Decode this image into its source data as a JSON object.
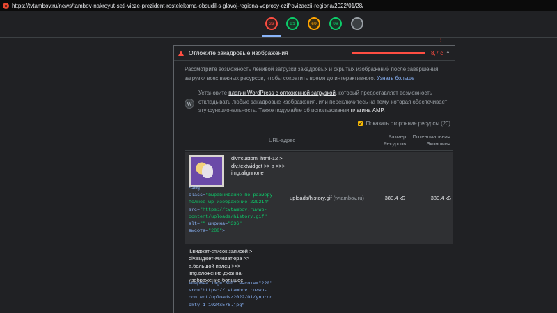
{
  "browser": {
    "url": "https://tvtambov.ru/news/tambov-nakroyut-seti-vicze-prezident-rostelekoma-obsudil-s-glavoj-regiona-voprosy-czifrovizaczii-regiona/2022/01/28/"
  },
  "scores": [
    {
      "label": "23",
      "status": "red",
      "active": true
    },
    {
      "label": "91",
      "status": "green",
      "active": false
    },
    {
      "label": "69",
      "status": "orange",
      "active": false
    },
    {
      "label": "98",
      "status": "green",
      "active": false
    },
    {
      "label": "—",
      "status": "pwa",
      "active": false
    }
  ],
  "marker": "!",
  "audit": {
    "title": "Отложите закадровые изображения",
    "savings": "8,7 с",
    "description_pre": "Рассмотрите возможность ленивой загрузки закадровых и скрытых изображений после завершения загрузки всех важных ресурсов, чтобы сократить время до интерактивного.",
    "description_link": "Узнать больше",
    "stack_icon_glyph": "W",
    "stack_pre": "Установите",
    "stack_link1": "плагин WordPress с отложенной загрузкой",
    "stack_mid": ", который предоставляет возможность откладывать любые закадровые изображения, или переключитесь на тему, которая обеспечивает эту функциональность. Также подумайте об использовании",
    "stack_link2": "плагина AMP",
    "stack_post": ".",
    "third_party_label": "Показать сторонние ресурсы (20)",
    "third_party_checked": true
  },
  "table": {
    "col_url": "URL-адрес",
    "col_size": "Размер Ресурсов",
    "col_savings": "Потенциальная Экономия",
    "rows": [
      {
        "node_label": "div#custom_html-12 > div.textwidget >> a >>> img.alignnone",
        "snippet": {
          "l1_tag": "<img",
          "l2_attr": "class=",
          "l2_val": "\"выравнивание по размеру-полное wp-изображение-229214\"",
          "l3_attr": "src=",
          "l3_val": "\"https://tvtambov.ru/wp-content/uploads/history.gif\"",
          "l4_attr": "alt=",
          "l4_val": "\"\"",
          "l4b_attr": "ширина=",
          "l4b_val": "\"336\"",
          "l5_attr": "высота=",
          "l5_val": "\"280\"",
          "l5_end": ">"
        },
        "url_path": "uploads/history.gif",
        "url_host": "(tvtambov.ru)",
        "size": "380,4 кБ",
        "savings": "380,4 кБ"
      },
      {
        "node_label": "li.виджет-список записей > div.виджет-миниатюра >> a.большой палец >>> img.вложение-джанна-изображение-большое",
        "snippet_text": "<ширина img=\"390\" высота=\"220\" src=\"https://tvtambov.ru/wp-content/uploads/2022/01/ynprod ckty-1-1024x576.jpg\""
      }
    ]
  }
}
